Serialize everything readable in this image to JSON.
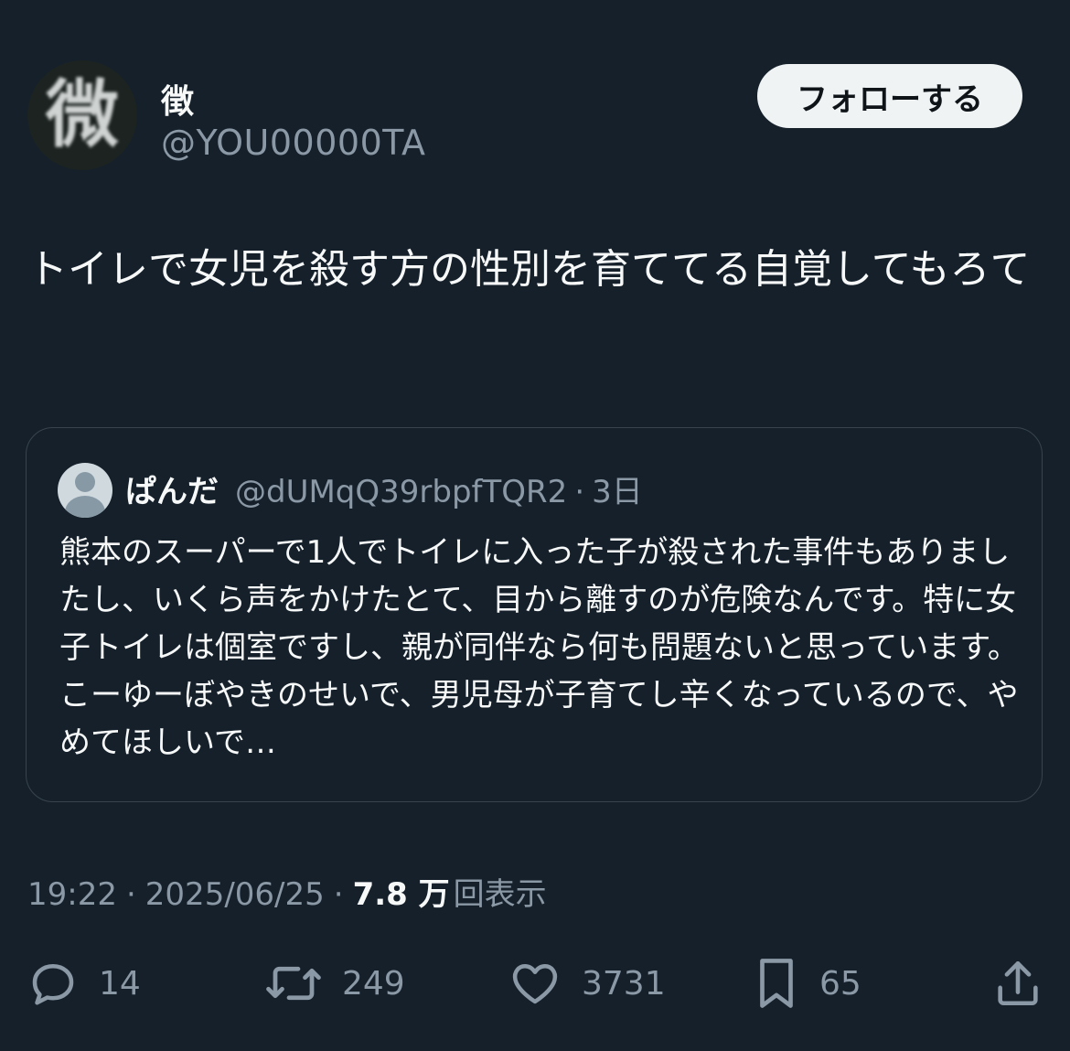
{
  "author": {
    "avatar_glyph": "微",
    "display_name": "徴",
    "handle": "@YOU00000TA"
  },
  "follow_button": {
    "label": "フォローする"
  },
  "tweet": {
    "text": "トイレで女児を殺す方の性別を育ててる自覚してもろて"
  },
  "quoted_tweet": {
    "name": "ぱんだ",
    "handle": "@dUMqQ39rbpfTQR2",
    "separator": "·",
    "time": "3日",
    "text": "熊本のスーパーで1人でトイレに入った子が殺された事件もありましたし、いくら声をかけたとて、目から離すのが危険なんです。特に女子トイレは個室ですし、親が同伴なら何も問題ないと思っています。こーゆーぼやきのせいで、男児母が子育てし辛くなっているので、やめてほしいで…"
  },
  "meta": {
    "time": "19:22",
    "separator": "·",
    "date": "2025/06/25",
    "views_count": "7.8 万",
    "views_label": "回表示"
  },
  "actions": {
    "replies": "14",
    "retweets": "249",
    "likes": "3731",
    "bookmarks": "65"
  },
  "colors": {
    "background": "#15202b",
    "text": "#f7f9f9",
    "secondary": "#8b98a5",
    "border": "#38444d",
    "follow_bg": "#eff3f4"
  }
}
